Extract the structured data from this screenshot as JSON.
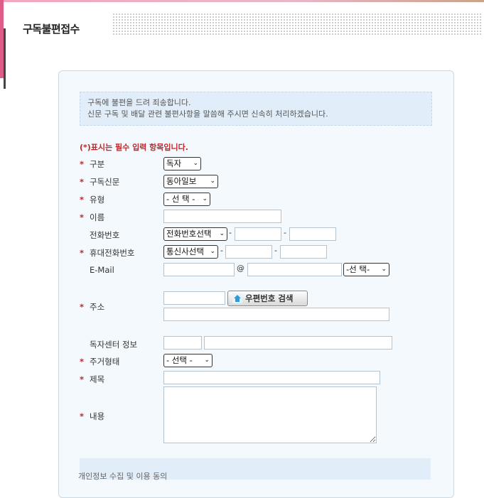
{
  "page": {
    "title": "구독불편접수"
  },
  "notice": {
    "line1": "구독에 불편을 드려 죄송합니다.",
    "line2": "신문 구독 및 배달 관련 불편사항을 말씀해 주시면 신속히 처리하겠습니다."
  },
  "required_note": "(*)표시는 필수 입력 항목입니다.",
  "form": {
    "category": {
      "label": "구분",
      "value": "독자"
    },
    "newspaper": {
      "label": "구독신문",
      "value": "동아일보"
    },
    "type": {
      "label": "유형",
      "value": "- 선 택 -"
    },
    "name": {
      "label": "이름"
    },
    "phone": {
      "label": "전화번호",
      "select": "전화번호선택",
      "sep": "-"
    },
    "mobile": {
      "label": "휴대전화번호",
      "select": "통신사선택",
      "sep": "-"
    },
    "email": {
      "label": "E-Mail",
      "at": "@",
      "domain_select": "-선 택-"
    },
    "address": {
      "label": "주소",
      "zip_button": "우편번호 검색"
    },
    "reader_center": {
      "label": "독자센터 정보"
    },
    "residence": {
      "label": "주거형태",
      "value": "- 선택 -"
    },
    "subject": {
      "label": "제목"
    },
    "content": {
      "label": "내용"
    }
  },
  "required_mark": "*",
  "bottom": {
    "text": "개인정보 수집 및 이용 동의"
  },
  "icons": {
    "select_arrow": "chevron-down-icon",
    "zip": "home-icon"
  }
}
